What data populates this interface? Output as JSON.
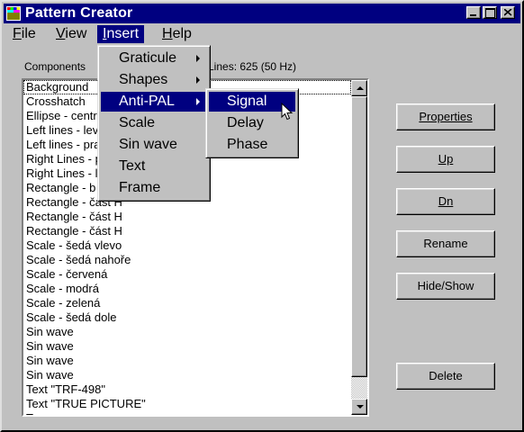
{
  "window": {
    "title": "Pattern Creator"
  },
  "menubar": [
    {
      "label_u": "F",
      "label_rest": "ile"
    },
    {
      "label_u": "V",
      "label_rest": "iew"
    },
    {
      "label_u": "I",
      "label_rest": "nsert"
    },
    {
      "label_u": "H",
      "label_rest": "elp"
    }
  ],
  "components_label": "Components",
  "lines_label": "Lines: 625 (50 Hz)",
  "components": [
    "Background",
    "Crosshatch",
    "Ellipse - centr",
    "Left lines - lev",
    "Left lines - pra",
    "Right Lines - p",
    "Right Lines - l",
    "Rectangle - b",
    "Rectangle - část H",
    "Rectangle - část H",
    "Rectangle - část H",
    "Scale - šedá vlevo",
    "Scale - šedá nahoře",
    "Scale - červená",
    "Scale - modrá",
    "Scale - zelená",
    "Scale - šedá dole",
    "Sin wave",
    "Sin wave",
    "Sin wave",
    "Sin wave",
    "Text \"TRF-498\"",
    "Text \"TRUE PICTURE\"",
    "T"
  ],
  "buttons": {
    "properties": "Properties",
    "up": "Up",
    "dn": "Dn",
    "rename": "Rename",
    "hide_show": "Hide/Show",
    "delete": "Delete"
  },
  "insert_menu": [
    {
      "label": "Graticule",
      "submenu": true
    },
    {
      "label": "Shapes",
      "submenu": true
    },
    {
      "label": "Anti-PAL",
      "submenu": true,
      "highlighted": true
    },
    {
      "label": "Scale",
      "submenu": false
    },
    {
      "label": "Sin wave",
      "submenu": false
    },
    {
      "label": "Text",
      "submenu": false
    },
    {
      "label": "Frame",
      "submenu": false
    }
  ],
  "antipal_submenu": [
    {
      "label": "Signal",
      "highlighted": true
    },
    {
      "label": "Delay"
    },
    {
      "label": "Phase"
    }
  ],
  "colors": {
    "titlebar": "#000080",
    "face": "#c0c0c0",
    "highlight": "#000080"
  }
}
